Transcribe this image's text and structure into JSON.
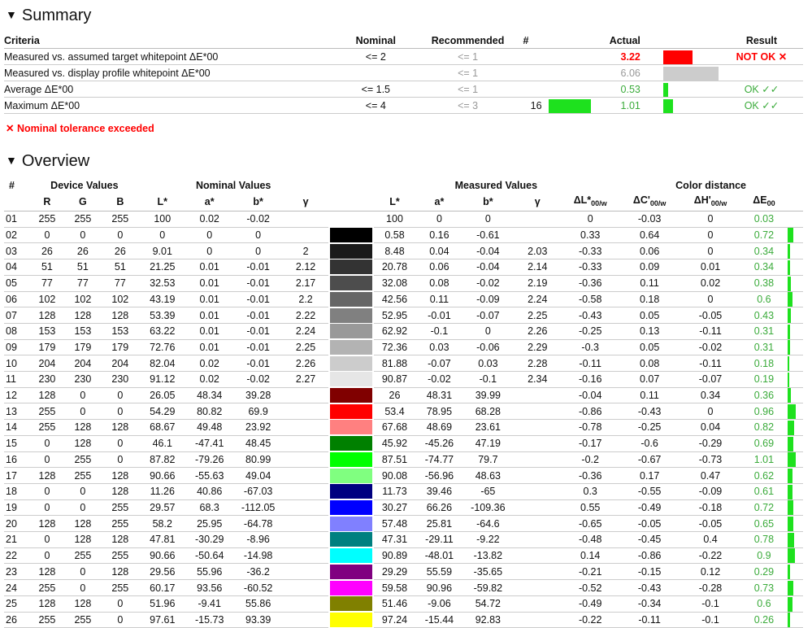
{
  "summary": {
    "heading": "Summary",
    "headers": {
      "criteria": "Criteria",
      "nominal": "Nominal",
      "recommended": "Recommended",
      "count": "#",
      "actual": "Actual",
      "result": "Result"
    },
    "rows": [
      {
        "criteria": "Measured vs. assumed target whitepoint ΔE*00",
        "nominal": "<= 2",
        "recommended": "<= 1",
        "count": "",
        "actual": "3.22",
        "actual_status": "fail",
        "actual_bar_fraction": 0.53,
        "actual_bar_color": "#ff0000",
        "result": "NOT OK ✕",
        "result_status": "fail"
      },
      {
        "criteria": "Measured vs. display profile whitepoint ΔE*00",
        "nominal": "",
        "recommended": "<= 1",
        "count": "",
        "actual": "6.06",
        "actual_status": "info",
        "actual_bar_fraction": 1.0,
        "actual_bar_color": "#cccccc",
        "result": "",
        "result_status": "none"
      },
      {
        "criteria": "Average ΔE*00",
        "nominal": "<= 1.5",
        "recommended": "<= 1",
        "count": "",
        "actual": "0.53",
        "actual_status": "pass",
        "actual_bar_fraction": 0.09,
        "actual_bar_color": "#1ee11e",
        "result": "OK ✓✓",
        "result_status": "pass"
      },
      {
        "criteria": "Maximum ΔE*00",
        "nominal": "<= 4",
        "recommended": "<= 3",
        "count": "16",
        "count_bar": true,
        "actual": "1.01",
        "actual_status": "pass",
        "actual_bar_fraction": 0.17,
        "actual_bar_color": "#1ee11e",
        "result": "OK ✓✓",
        "result_status": "pass"
      }
    ],
    "tolerance_message": "✕ Nominal tolerance exceeded"
  },
  "overview": {
    "heading": "Overview",
    "group_headers": {
      "index": "#",
      "device": "Device Values",
      "nominal": "Nominal Values",
      "measured": "Measured Values",
      "distance": "Color distance"
    },
    "column_headers": {
      "r": "R",
      "g": "G",
      "b": "B",
      "L": "L*",
      "a": "a*",
      "bb": "b*",
      "gamma": "γ",
      "mL": "L*",
      "ma": "a*",
      "mb": "b*",
      "mgamma": "γ",
      "dL": "ΔL*",
      "dC": "ΔC'",
      "dH": "ΔH'",
      "dE": "ΔE",
      "sub_w": "00/w",
      "sub": "00"
    },
    "rows": [
      {
        "idx": "01",
        "r": "255",
        "g": "255",
        "b": "255",
        "L": "100",
        "a": "0.02",
        "bb": "-0.02",
        "gamma": "",
        "color": "#ffffff",
        "mL": "100",
        "ma": "0",
        "mb": "0",
        "mgamma": "",
        "dL": "0",
        "dC": "-0.03",
        "dH": "0",
        "dE": "0.03"
      },
      {
        "idx": "02",
        "r": "0",
        "g": "0",
        "b": "0",
        "L": "0",
        "a": "0",
        "bb": "0",
        "gamma": "",
        "color": "#000000",
        "mL": "0.58",
        "ma": "0.16",
        "mb": "-0.61",
        "mgamma": "",
        "dL": "0.33",
        "dC": "0.64",
        "dH": "0",
        "dE": "0.72"
      },
      {
        "idx": "03",
        "r": "26",
        "g": "26",
        "b": "26",
        "L": "9.01",
        "a": "0",
        "bb": "0",
        "gamma": "2",
        "color": "#1a1a1a",
        "mL": "8.48",
        "ma": "0.04",
        "mb": "-0.04",
        "mgamma": "2.03",
        "dL": "-0.33",
        "dC": "0.06",
        "dH": "0",
        "dE": "0.34"
      },
      {
        "idx": "04",
        "r": "51",
        "g": "51",
        "b": "51",
        "L": "21.25",
        "a": "0.01",
        "bb": "-0.01",
        "gamma": "2.12",
        "color": "#333333",
        "mL": "20.78",
        "ma": "0.06",
        "mb": "-0.04",
        "mgamma": "2.14",
        "dL": "-0.33",
        "dC": "0.09",
        "dH": "0.01",
        "dE": "0.34"
      },
      {
        "idx": "05",
        "r": "77",
        "g": "77",
        "b": "77",
        "L": "32.53",
        "a": "0.01",
        "bb": "-0.01",
        "gamma": "2.17",
        "color": "#4d4d4d",
        "mL": "32.08",
        "ma": "0.08",
        "mb": "-0.02",
        "mgamma": "2.19",
        "dL": "-0.36",
        "dC": "0.11",
        "dH": "0.02",
        "dE": "0.38"
      },
      {
        "idx": "06",
        "r": "102",
        "g": "102",
        "b": "102",
        "L": "43.19",
        "a": "0.01",
        "bb": "-0.01",
        "gamma": "2.2",
        "color": "#666666",
        "mL": "42.56",
        "ma": "0.11",
        "mb": "-0.09",
        "mgamma": "2.24",
        "dL": "-0.58",
        "dC": "0.18",
        "dH": "0",
        "dE": "0.6"
      },
      {
        "idx": "07",
        "r": "128",
        "g": "128",
        "b": "128",
        "L": "53.39",
        "a": "0.01",
        "bb": "-0.01",
        "gamma": "2.22",
        "color": "#808080",
        "mL": "52.95",
        "ma": "-0.01",
        "mb": "-0.07",
        "mgamma": "2.25",
        "dL": "-0.43",
        "dC": "0.05",
        "dH": "-0.05",
        "dE": "0.43"
      },
      {
        "idx": "08",
        "r": "153",
        "g": "153",
        "b": "153",
        "L": "63.22",
        "a": "0.01",
        "bb": "-0.01",
        "gamma": "2.24",
        "color": "#999999",
        "mL": "62.92",
        "ma": "-0.1",
        "mb": "0",
        "mgamma": "2.26",
        "dL": "-0.25",
        "dC": "0.13",
        "dH": "-0.11",
        "dE": "0.31"
      },
      {
        "idx": "09",
        "r": "179",
        "g": "179",
        "b": "179",
        "L": "72.76",
        "a": "0.01",
        "bb": "-0.01",
        "gamma": "2.25",
        "color": "#b3b3b3",
        "mL": "72.36",
        "ma": "0.03",
        "mb": "-0.06",
        "mgamma": "2.29",
        "dL": "-0.3",
        "dC": "0.05",
        "dH": "-0.02",
        "dE": "0.31"
      },
      {
        "idx": "10",
        "r": "204",
        "g": "204",
        "b": "204",
        "L": "82.04",
        "a": "0.02",
        "bb": "-0.01",
        "gamma": "2.26",
        "color": "#cccccc",
        "mL": "81.88",
        "ma": "-0.07",
        "mb": "0.03",
        "mgamma": "2.28",
        "dL": "-0.11",
        "dC": "0.08",
        "dH": "-0.11",
        "dE": "0.18"
      },
      {
        "idx": "11",
        "r": "230",
        "g": "230",
        "b": "230",
        "L": "91.12",
        "a": "0.02",
        "bb": "-0.02",
        "gamma": "2.27",
        "color": "#e6e6e6",
        "mL": "90.87",
        "ma": "-0.02",
        "mb": "-0.1",
        "mgamma": "2.34",
        "dL": "-0.16",
        "dC": "0.07",
        "dH": "-0.07",
        "dE": "0.19"
      },
      {
        "idx": "12",
        "r": "128",
        "g": "0",
        "b": "0",
        "L": "26.05",
        "a": "48.34",
        "bb": "39.28",
        "gamma": "",
        "color": "#800000",
        "mL": "26",
        "ma": "48.31",
        "mb": "39.99",
        "mgamma": "",
        "dL": "-0.04",
        "dC": "0.11",
        "dH": "0.34",
        "dE": "0.36"
      },
      {
        "idx": "13",
        "r": "255",
        "g": "0",
        "b": "0",
        "L": "54.29",
        "a": "80.82",
        "bb": "69.9",
        "gamma": "",
        "color": "#ff0000",
        "mL": "53.4",
        "ma": "78.95",
        "mb": "68.28",
        "mgamma": "",
        "dL": "-0.86",
        "dC": "-0.43",
        "dH": "0",
        "dE": "0.96"
      },
      {
        "idx": "14",
        "r": "255",
        "g": "128",
        "b": "128",
        "L": "68.67",
        "a": "49.48",
        "bb": "23.92",
        "gamma": "",
        "color": "#ff8080",
        "mL": "67.68",
        "ma": "48.69",
        "mb": "23.61",
        "mgamma": "",
        "dL": "-0.78",
        "dC": "-0.25",
        "dH": "0.04",
        "dE": "0.82"
      },
      {
        "idx": "15",
        "r": "0",
        "g": "128",
        "b": "0",
        "L": "46.1",
        "a": "-47.41",
        "bb": "48.45",
        "gamma": "",
        "color": "#008000",
        "mL": "45.92",
        "ma": "-45.26",
        "mb": "47.19",
        "mgamma": "",
        "dL": "-0.17",
        "dC": "-0.6",
        "dH": "-0.29",
        "dE": "0.69"
      },
      {
        "idx": "16",
        "r": "0",
        "g": "255",
        "b": "0",
        "L": "87.82",
        "a": "-79.26",
        "bb": "80.99",
        "gamma": "",
        "color": "#00ff00",
        "mL": "87.51",
        "ma": "-74.77",
        "mb": "79.7",
        "mgamma": "",
        "dL": "-0.2",
        "dC": "-0.67",
        "dH": "-0.73",
        "dE": "1.01"
      },
      {
        "idx": "17",
        "r": "128",
        "g": "255",
        "b": "128",
        "L": "90.66",
        "a": "-55.63",
        "bb": "49.04",
        "gamma": "",
        "color": "#80ff80",
        "mL": "90.08",
        "ma": "-56.96",
        "mb": "48.63",
        "mgamma": "",
        "dL": "-0.36",
        "dC": "0.17",
        "dH": "0.47",
        "dE": "0.62"
      },
      {
        "idx": "18",
        "r": "0",
        "g": "0",
        "b": "128",
        "L": "11.26",
        "a": "40.86",
        "bb": "-67.03",
        "gamma": "",
        "color": "#000080",
        "mL": "11.73",
        "ma": "39.46",
        "mb": "-65",
        "mgamma": "",
        "dL": "0.3",
        "dC": "-0.55",
        "dH": "-0.09",
        "dE": "0.61"
      },
      {
        "idx": "19",
        "r": "0",
        "g": "0",
        "b": "255",
        "L": "29.57",
        "a": "68.3",
        "bb": "-112.05",
        "gamma": "",
        "color": "#0000ff",
        "mL": "30.27",
        "ma": "66.26",
        "mb": "-109.36",
        "mgamma": "",
        "dL": "0.55",
        "dC": "-0.49",
        "dH": "-0.18",
        "dE": "0.72"
      },
      {
        "idx": "20",
        "r": "128",
        "g": "128",
        "b": "255",
        "L": "58.2",
        "a": "25.95",
        "bb": "-64.78",
        "gamma": "",
        "color": "#8080ff",
        "mL": "57.48",
        "ma": "25.81",
        "mb": "-64.6",
        "mgamma": "",
        "dL": "-0.65",
        "dC": "-0.05",
        "dH": "-0.05",
        "dE": "0.65"
      },
      {
        "idx": "21",
        "r": "0",
        "g": "128",
        "b": "128",
        "L": "47.81",
        "a": "-30.29",
        "bb": "-8.96",
        "gamma": "",
        "color": "#008080",
        "mL": "47.31",
        "ma": "-29.11",
        "mb": "-9.22",
        "mgamma": "",
        "dL": "-0.48",
        "dC": "-0.45",
        "dH": "0.4",
        "dE": "0.78"
      },
      {
        "idx": "22",
        "r": "0",
        "g": "255",
        "b": "255",
        "L": "90.66",
        "a": "-50.64",
        "bb": "-14.98",
        "gamma": "",
        "color": "#00ffff",
        "mL": "90.89",
        "ma": "-48.01",
        "mb": "-13.82",
        "mgamma": "",
        "dL": "0.14",
        "dC": "-0.86",
        "dH": "-0.22",
        "dE": "0.9"
      },
      {
        "idx": "23",
        "r": "128",
        "g": "0",
        "b": "128",
        "L": "29.56",
        "a": "55.96",
        "bb": "-36.2",
        "gamma": "",
        "color": "#800080",
        "mL": "29.29",
        "ma": "55.59",
        "mb": "-35.65",
        "mgamma": "",
        "dL": "-0.21",
        "dC": "-0.15",
        "dH": "0.12",
        "dE": "0.29"
      },
      {
        "idx": "24",
        "r": "255",
        "g": "0",
        "b": "255",
        "L": "60.17",
        "a": "93.56",
        "bb": "-60.52",
        "gamma": "",
        "color": "#ff00ff",
        "mL": "59.58",
        "ma": "90.96",
        "mb": "-59.82",
        "mgamma": "",
        "dL": "-0.52",
        "dC": "-0.43",
        "dH": "-0.28",
        "dE": "0.73"
      },
      {
        "idx": "25",
        "r": "128",
        "g": "128",
        "b": "0",
        "L": "51.96",
        "a": "-9.41",
        "bb": "55.86",
        "gamma": "",
        "color": "#808000",
        "mL": "51.46",
        "ma": "-9.06",
        "mb": "54.72",
        "mgamma": "",
        "dL": "-0.49",
        "dC": "-0.34",
        "dH": "-0.1",
        "dE": "0.6"
      },
      {
        "idx": "26",
        "r": "255",
        "g": "255",
        "b": "0",
        "L": "97.61",
        "a": "-15.73",
        "bb": "93.39",
        "gamma": "",
        "color": "#ffff00",
        "mL": "97.24",
        "ma": "-15.44",
        "mb": "92.83",
        "mgamma": "",
        "dL": "-0.22",
        "dC": "-0.11",
        "dH": "-0.1",
        "dE": "0.26"
      }
    ]
  }
}
